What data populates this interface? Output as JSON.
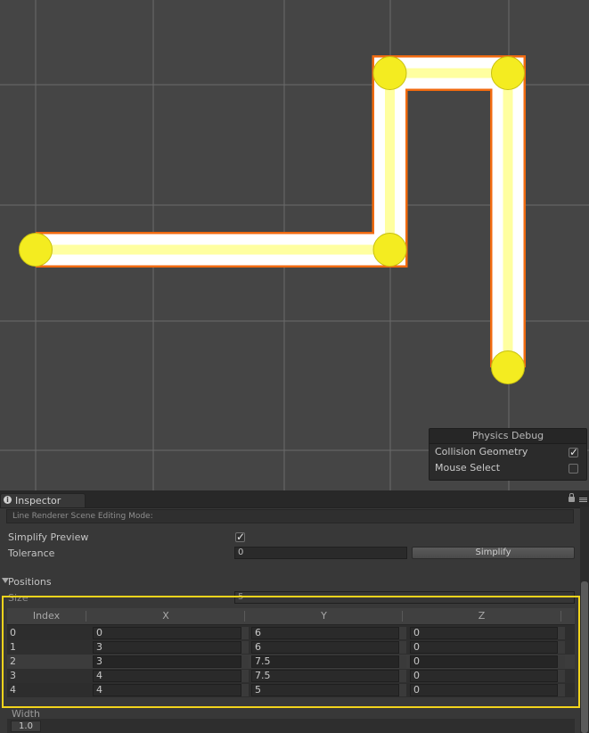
{
  "scene": {
    "line_points": [
      [
        0,
        6
      ],
      [
        3,
        6
      ],
      [
        3,
        7.5
      ],
      [
        4,
        7.5
      ],
      [
        4,
        5
      ]
    ],
    "colors": {
      "background": "#454545",
      "grid": "#6a6a6a",
      "outline": "#f06a10",
      "fill": "#ffffff",
      "centerline": "#ffff78",
      "handle": "#f4ec20"
    }
  },
  "physics_debug": {
    "title": "Physics Debug",
    "items": [
      {
        "label": "Collision Geometry",
        "checked": true
      },
      {
        "label": "Mouse Select",
        "checked": false
      }
    ]
  },
  "inspector": {
    "tab_label": "Inspector",
    "edit_mode_label": "Line Renderer Scene Editing Mode:",
    "simplify_preview_label": "Simplify Preview",
    "simplify_preview_checked": true,
    "tolerance_label": "Tolerance",
    "tolerance_value": "0",
    "simplify_button": "Simplify",
    "positions_label": "Positions",
    "size_label": "Size",
    "size_value": "5",
    "table": {
      "headers": [
        "Index",
        "X",
        "Y",
        "Z"
      ],
      "rows": [
        {
          "index": "0",
          "x": "0",
          "y": "6",
          "z": "0"
        },
        {
          "index": "1",
          "x": "3",
          "y": "6",
          "z": "0"
        },
        {
          "index": "2",
          "x": "3",
          "y": "7.5",
          "z": "0"
        },
        {
          "index": "3",
          "x": "4",
          "y": "7.5",
          "z": "0"
        },
        {
          "index": "4",
          "x": "4",
          "y": "5",
          "z": "0"
        }
      ],
      "selected_row": 2
    },
    "width_label": "Width",
    "width_value": "1.0"
  }
}
